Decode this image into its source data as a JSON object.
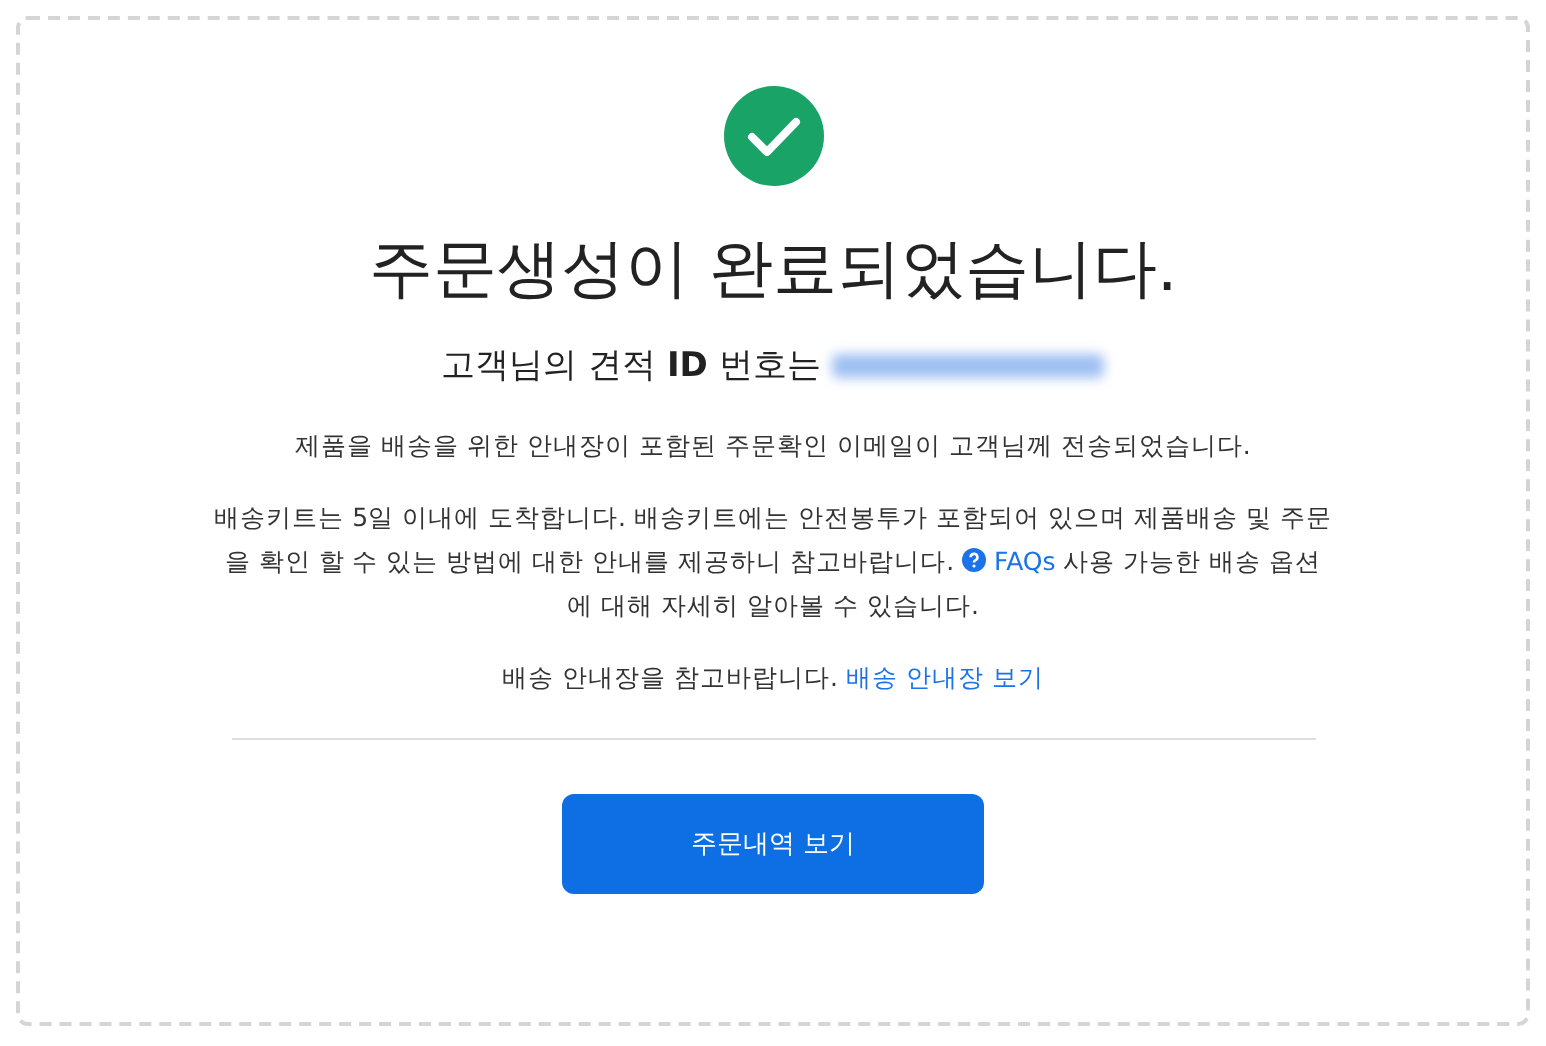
{
  "title": "주문생성이 완료되었습니다.",
  "subtitle": {
    "text": "고객님의 견적",
    "bold": "ID",
    "tail": "번호는"
  },
  "paragraphs": [
    {
      "text": "제품을 배송을 위한 안내장이 포함된 주문확인 이메일이 고객님께 전송되었습니다."
    },
    {
      "text": "배송키트는 5일 이내에 도착합니다. 배송키트에는 안전봉투가 포함되어 있으며 제품배송 및 주문을 확인 할 수 있는 방법에 대한 안내를 제공하니 참고바랍니다.",
      "link": "FAQs",
      "tail": "사용 가능한 배송 옵션에 대해 자세히 알아볼 수 있습니다."
    },
    {
      "text": "배송 안내장을 참고바랍니다.",
      "link": "배송 안내장 보기"
    }
  ],
  "button": "주문내역 보기"
}
